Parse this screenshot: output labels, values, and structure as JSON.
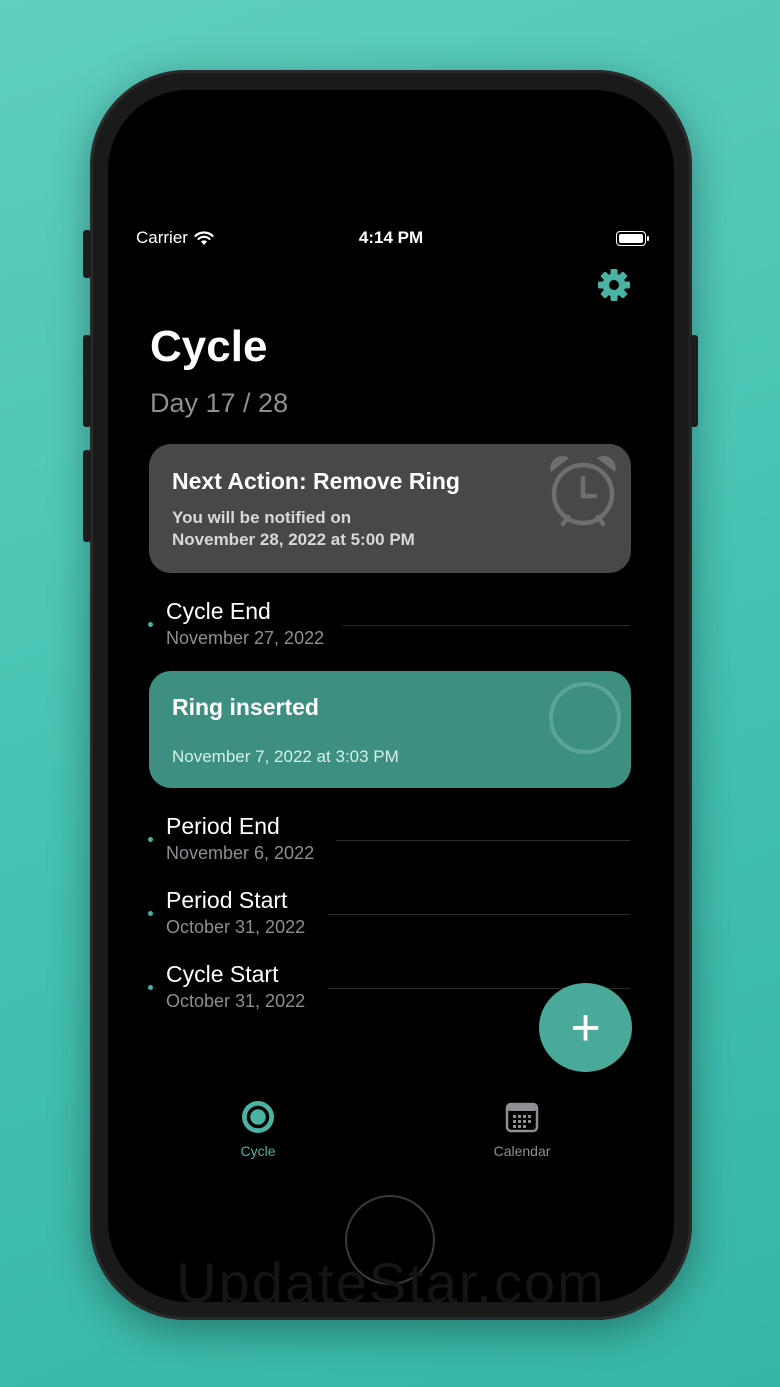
{
  "status_bar": {
    "carrier": "Carrier",
    "time": "4:14 PM"
  },
  "header": {
    "title": "Cycle",
    "day": "Day 17 / 28"
  },
  "next_action": {
    "title": "Next Action: Remove Ring",
    "line1": "You will be notified on",
    "line2": "November 28, 2022 at 5:00 PM"
  },
  "ring_card": {
    "title": "Ring inserted",
    "date": "November 7, 2022 at 3:03 PM"
  },
  "events": [
    {
      "name": "Cycle End",
      "date": "November 27, 2022"
    },
    {
      "name": "Period End",
      "date": "November 6, 2022"
    },
    {
      "name": "Period Start",
      "date": "October 31, 2022"
    },
    {
      "name": "Cycle Start",
      "date": "October 31, 2022"
    }
  ],
  "fab": {
    "symbol": "+"
  },
  "tabs": [
    {
      "label": "Cycle",
      "icon": "ring-icon",
      "active": true
    },
    {
      "label": "Calendar",
      "icon": "calendar-icon",
      "active": false
    }
  ],
  "watermark": "UpdateStar.com",
  "colors": {
    "accent": "#4bb3a3",
    "card_next": "#48484a",
    "card_ring": "#3d8f80",
    "background": "#000000"
  }
}
